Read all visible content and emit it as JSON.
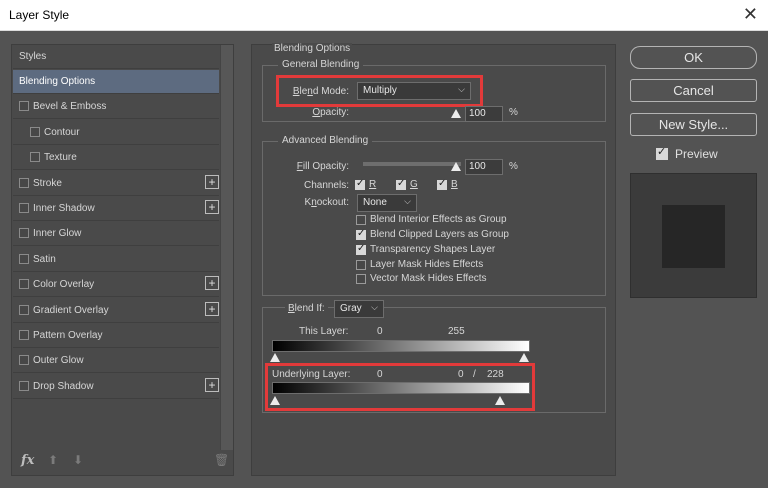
{
  "window": {
    "title": "Layer Style",
    "close_glyph": "✕"
  },
  "styles_panel": {
    "header": "Styles",
    "items": [
      {
        "label": "Blending Options",
        "checkbox": false,
        "plus": false,
        "selected": true
      },
      {
        "label": "Bevel & Emboss",
        "checkbox": true,
        "plus": false
      },
      {
        "label": "Contour",
        "checkbox": true,
        "plus": false,
        "indent": true
      },
      {
        "label": "Texture",
        "checkbox": true,
        "plus": false,
        "indent": true
      },
      {
        "label": "Stroke",
        "checkbox": true,
        "plus": true
      },
      {
        "label": "Inner Shadow",
        "checkbox": true,
        "plus": true
      },
      {
        "label": "Inner Glow",
        "checkbox": true,
        "plus": false
      },
      {
        "label": "Satin",
        "checkbox": true,
        "plus": false
      },
      {
        "label": "Color Overlay",
        "checkbox": true,
        "plus": true
      },
      {
        "label": "Gradient Overlay",
        "checkbox": true,
        "plus": true
      },
      {
        "label": "Pattern Overlay",
        "checkbox": true,
        "plus": false
      },
      {
        "label": "Outer Glow",
        "checkbox": true,
        "plus": false
      },
      {
        "label": "Drop Shadow",
        "checkbox": true,
        "plus": true
      }
    ],
    "footer": {
      "fx": "fx",
      "up": "⬆",
      "down": "⬇",
      "trash": "🗑"
    }
  },
  "blending_options": {
    "title": "Blending Options",
    "general": {
      "title": "General Blending",
      "blend_mode_label": "Blend Mode:",
      "blend_mode_value": "Multiply",
      "opacity_label": "Opacity:",
      "opacity_value": "100",
      "opacity_unit": "%"
    },
    "advanced": {
      "title": "Advanced Blending",
      "fill_opacity_label": "Fill Opacity:",
      "fill_opacity_value": "100",
      "fill_unit": "%",
      "channels_label": "Channels:",
      "channel_r": "R",
      "channel_g": "G",
      "channel_b": "B",
      "knockout_label": "Knockout:",
      "knockout_value": "None",
      "options": [
        {
          "label": "Blend Interior Effects as Group",
          "checked": false
        },
        {
          "label": "Blend Clipped Layers as Group",
          "checked": true
        },
        {
          "label": "Transparency Shapes Layer",
          "checked": true
        },
        {
          "label": "Layer Mask Hides Effects",
          "checked": false
        },
        {
          "label": "Vector Mask Hides Effects",
          "checked": false
        }
      ]
    },
    "blend_if": {
      "label": "Blend If:",
      "value": "Gray",
      "this_layer_label": "This Layer:",
      "this_layer_low": "0",
      "this_layer_high": "255",
      "underlying_label": "Underlying Layer:",
      "underlying_low": "0",
      "underlying_split_a": "0",
      "underlying_slash": "/",
      "underlying_split_b": "228"
    }
  },
  "buttons": {
    "ok": "OK",
    "cancel": "Cancel",
    "new_style": "New Style...",
    "preview": "Preview"
  },
  "colors": {
    "panel": "#4a4a4a",
    "window": "#535353",
    "highlight": "#e23a3a",
    "selected_row": "#5d6b80"
  }
}
